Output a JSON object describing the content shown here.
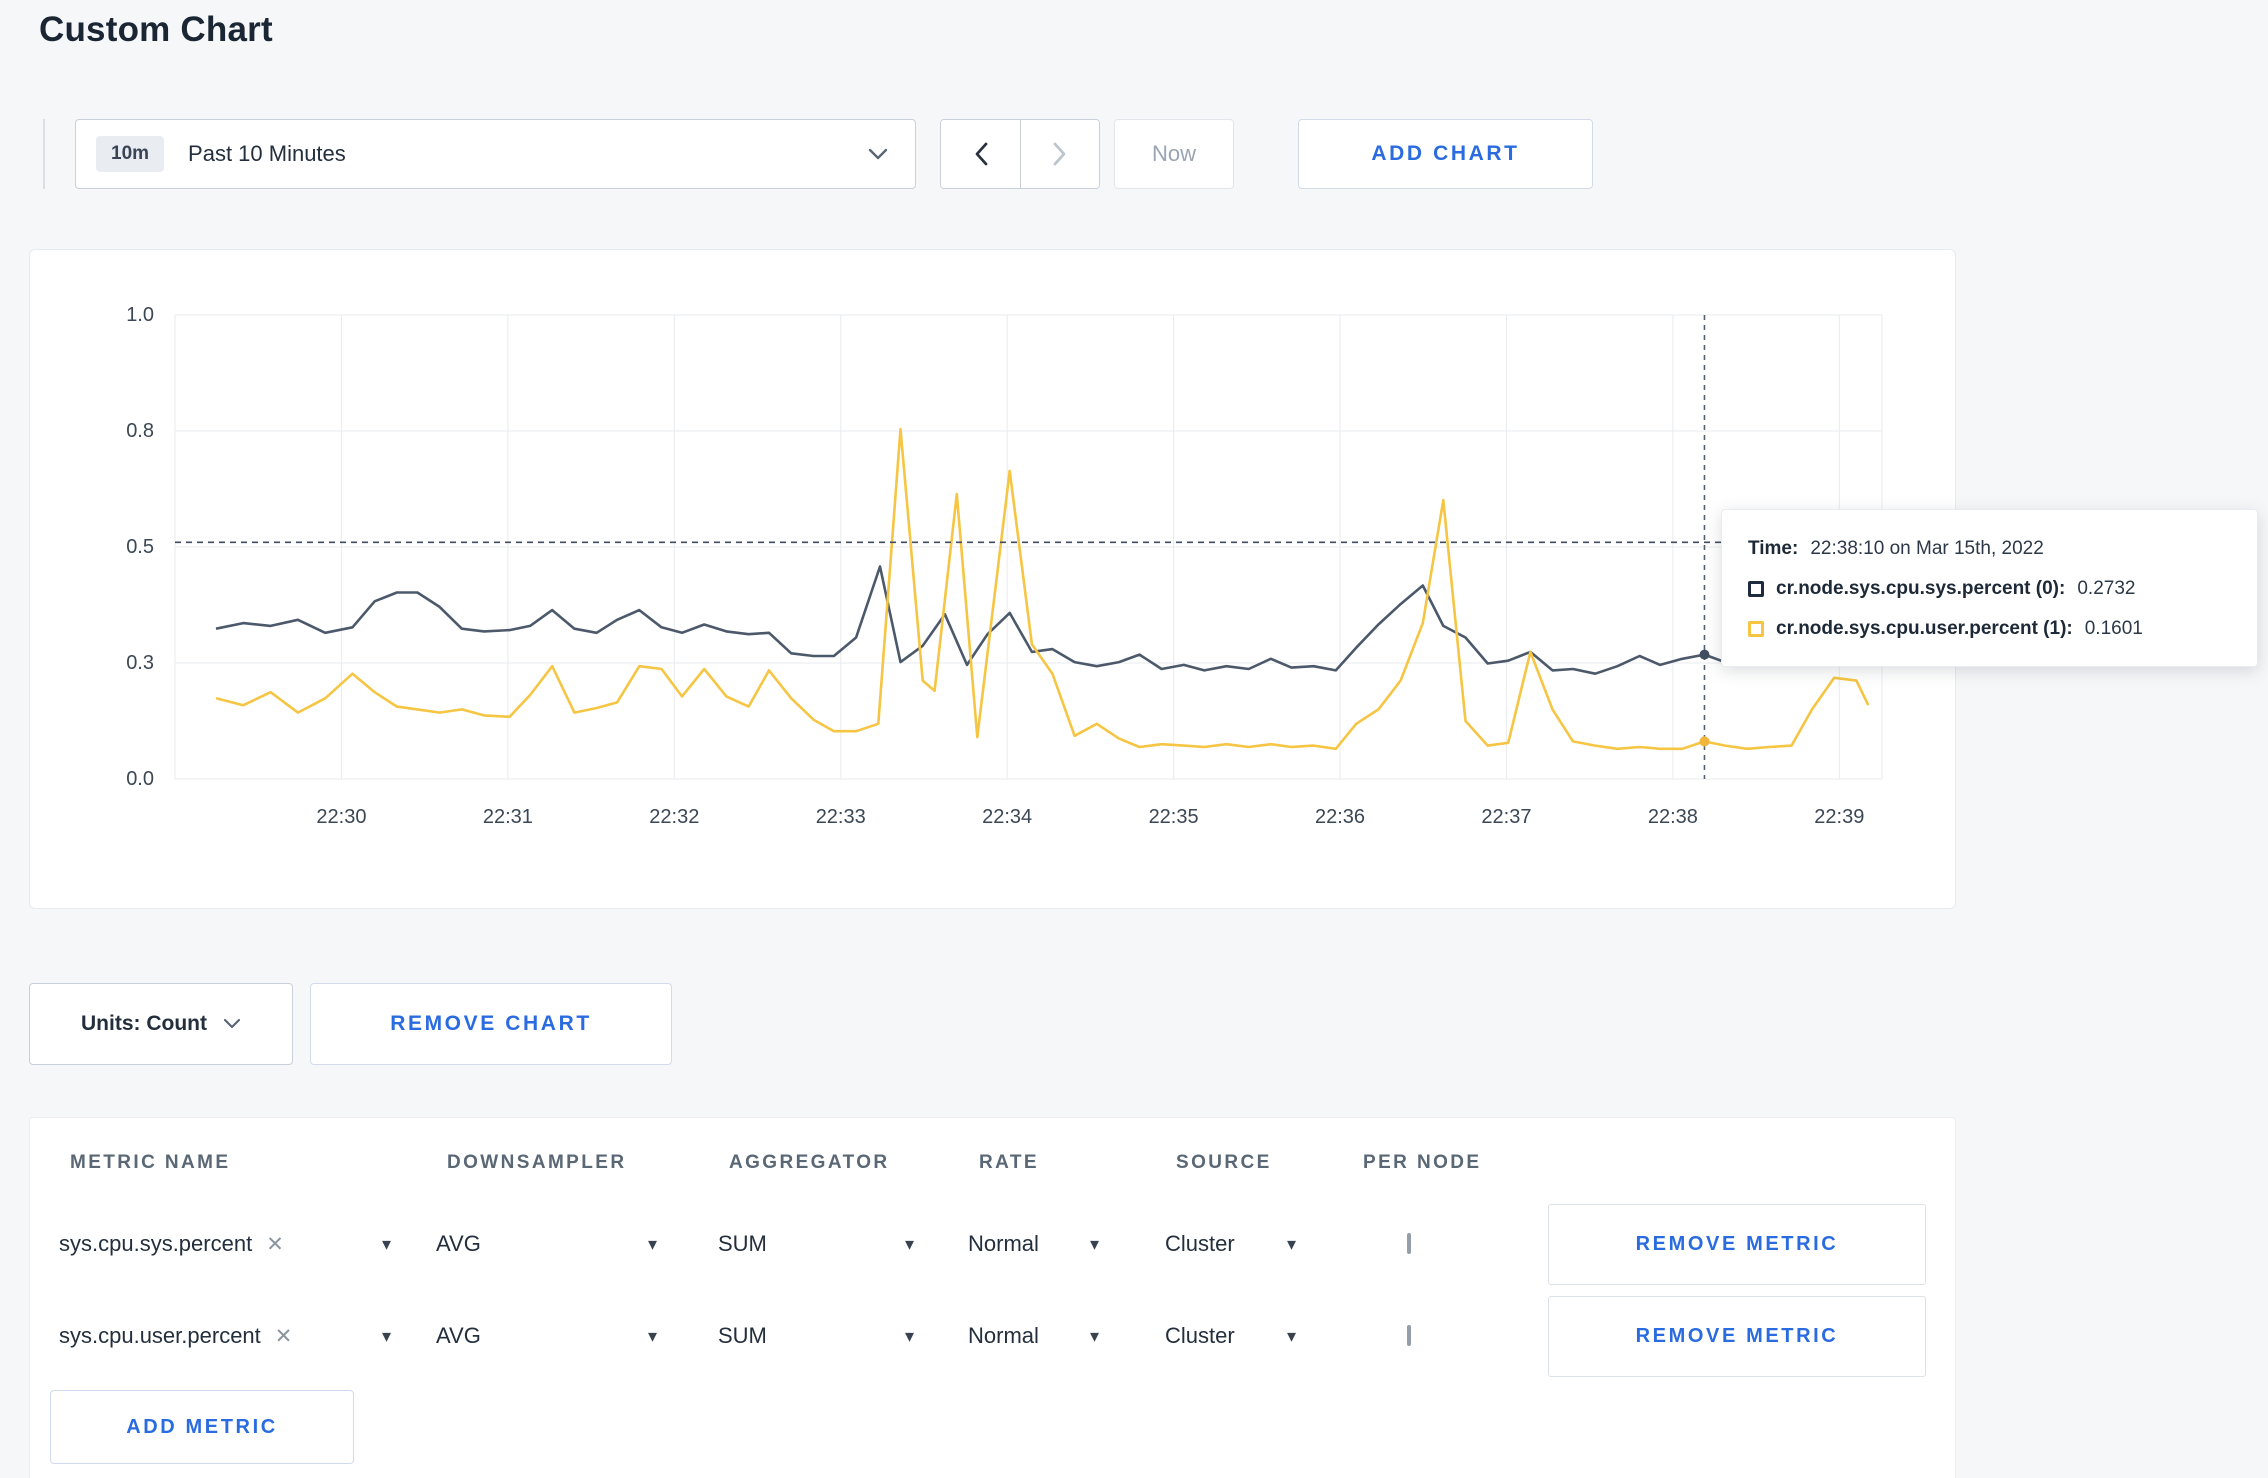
{
  "page": {
    "title": "Custom Chart"
  },
  "toolbar": {
    "time_badge": "10m",
    "time_label": "Past 10 Minutes",
    "now_label": "Now",
    "add_chart_label": "ADD CHART"
  },
  "chart": {
    "y_ticks": [
      "1.0",
      "0.8",
      "0.5",
      "0.3",
      "0.0"
    ],
    "y_grid": [
      0,
      0.25,
      0.5,
      0.75,
      1
    ],
    "x_ticks": [
      "22:30",
      "22:31",
      "22:32",
      "22:33",
      "22:34",
      "22:35",
      "22:36",
      "22:37",
      "22:38",
      "22:39"
    ],
    "x_grid": [
      0.0975,
      0.195,
      0.2925,
      0.39,
      0.4875,
      0.585,
      0.6825,
      0.78,
      0.8775,
      0.975
    ],
    "grid_color": "#e9ebee",
    "hline_fy": 0.49,
    "hline_color": "#3f4c60",
    "crosshair": {
      "fx": 0.896,
      "color": "#55606e",
      "markers": [
        {
          "fy": 0.732,
          "color": "#414e60"
        },
        {
          "fy": 0.919,
          "color": "#f0b63b"
        }
      ]
    },
    "series": [
      {
        "id": "sys-percent",
        "name": "cr.node.sys.cpu.sys.percent",
        "color": "#4c596b",
        "points": [
          [
            0.024,
            0.676
          ],
          [
            0.04,
            0.664
          ],
          [
            0.056,
            0.67
          ],
          [
            0.072,
            0.657
          ],
          [
            0.088,
            0.685
          ],
          [
            0.104,
            0.673
          ],
          [
            0.117,
            0.617
          ],
          [
            0.13,
            0.598
          ],
          [
            0.142,
            0.598
          ],
          [
            0.155,
            0.629
          ],
          [
            0.168,
            0.676
          ],
          [
            0.181,
            0.682
          ],
          [
            0.196,
            0.679
          ],
          [
            0.208,
            0.67
          ],
          [
            0.221,
            0.636
          ],
          [
            0.234,
            0.676
          ],
          [
            0.247,
            0.685
          ],
          [
            0.259,
            0.657
          ],
          [
            0.272,
            0.636
          ],
          [
            0.285,
            0.673
          ],
          [
            0.297,
            0.685
          ],
          [
            0.31,
            0.667
          ],
          [
            0.323,
            0.682
          ],
          [
            0.336,
            0.688
          ],
          [
            0.348,
            0.685
          ],
          [
            0.361,
            0.729
          ],
          [
            0.374,
            0.735
          ],
          [
            0.386,
            0.735
          ],
          [
            0.399,
            0.695
          ],
          [
            0.413,
            0.542
          ],
          [
            0.425,
            0.748
          ],
          [
            0.438,
            0.713
          ],
          [
            0.451,
            0.645
          ],
          [
            0.464,
            0.754
          ],
          [
            0.476,
            0.688
          ],
          [
            0.489,
            0.642
          ],
          [
            0.502,
            0.726
          ],
          [
            0.514,
            0.72
          ],
          [
            0.527,
            0.748
          ],
          [
            0.54,
            0.757
          ],
          [
            0.553,
            0.748
          ],
          [
            0.565,
            0.732
          ],
          [
            0.578,
            0.763
          ],
          [
            0.591,
            0.754
          ],
          [
            0.603,
            0.766
          ],
          [
            0.616,
            0.757
          ],
          [
            0.629,
            0.763
          ],
          [
            0.642,
            0.741
          ],
          [
            0.654,
            0.76
          ],
          [
            0.667,
            0.757
          ],
          [
            0.68,
            0.766
          ],
          [
            0.692,
            0.717
          ],
          [
            0.705,
            0.667
          ],
          [
            0.718,
            0.623
          ],
          [
            0.731,
            0.583
          ],
          [
            0.743,
            0.67
          ],
          [
            0.756,
            0.695
          ],
          [
            0.769,
            0.751
          ],
          [
            0.781,
            0.745
          ],
          [
            0.794,
            0.726
          ],
          [
            0.807,
            0.766
          ],
          [
            0.819,
            0.763
          ],
          [
            0.832,
            0.773
          ],
          [
            0.845,
            0.757
          ],
          [
            0.858,
            0.735
          ],
          [
            0.87,
            0.754
          ],
          [
            0.883,
            0.741
          ],
          [
            0.896,
            0.732
          ],
          [
            0.908,
            0.748
          ],
          [
            0.921,
            0.726
          ],
          [
            0.934,
            0.735
          ],
          [
            0.947,
            0.741
          ],
          [
            0.959,
            0.751
          ],
          [
            0.972,
            0.741
          ],
          [
            0.985,
            0.751
          ]
        ]
      },
      {
        "id": "user-percent",
        "name": "cr.node.sys.cpu.user.percent",
        "color": "#f5c543",
        "points": [
          [
            0.024,
            0.826
          ],
          [
            0.04,
            0.841
          ],
          [
            0.056,
            0.813
          ],
          [
            0.072,
            0.857
          ],
          [
            0.088,
            0.826
          ],
          [
            0.104,
            0.773
          ],
          [
            0.117,
            0.813
          ],
          [
            0.13,
            0.844
          ],
          [
            0.142,
            0.85
          ],
          [
            0.155,
            0.857
          ],
          [
            0.168,
            0.85
          ],
          [
            0.181,
            0.863
          ],
          [
            0.196,
            0.866
          ],
          [
            0.208,
            0.819
          ],
          [
            0.221,
            0.757
          ],
          [
            0.234,
            0.857
          ],
          [
            0.247,
            0.847
          ],
          [
            0.259,
            0.835
          ],
          [
            0.272,
            0.757
          ],
          [
            0.285,
            0.763
          ],
          [
            0.297,
            0.822
          ],
          [
            0.31,
            0.763
          ],
          [
            0.323,
            0.822
          ],
          [
            0.336,
            0.844
          ],
          [
            0.348,
            0.766
          ],
          [
            0.361,
            0.826
          ],
          [
            0.374,
            0.872
          ],
          [
            0.386,
            0.897
          ],
          [
            0.399,
            0.897
          ],
          [
            0.412,
            0.881
          ],
          [
            0.425,
            0.246
          ],
          [
            0.438,
            0.788
          ],
          [
            0.445,
            0.81
          ],
          [
            0.458,
            0.386
          ],
          [
            0.47,
            0.91
          ],
          [
            0.489,
            0.336
          ],
          [
            0.502,
            0.71
          ],
          [
            0.514,
            0.773
          ],
          [
            0.527,
            0.907
          ],
          [
            0.54,
            0.881
          ],
          [
            0.553,
            0.913
          ],
          [
            0.565,
            0.931
          ],
          [
            0.578,
            0.925
          ],
          [
            0.591,
            0.928
          ],
          [
            0.603,
            0.931
          ],
          [
            0.616,
            0.925
          ],
          [
            0.629,
            0.931
          ],
          [
            0.642,
            0.925
          ],
          [
            0.654,
            0.931
          ],
          [
            0.667,
            0.928
          ],
          [
            0.68,
            0.935
          ],
          [
            0.692,
            0.881
          ],
          [
            0.705,
            0.85
          ],
          [
            0.718,
            0.788
          ],
          [
            0.731,
            0.664
          ],
          [
            0.743,
            0.399
          ],
          [
            0.756,
            0.875
          ],
          [
            0.769,
            0.928
          ],
          [
            0.781,
            0.922
          ],
          [
            0.794,
            0.726
          ],
          [
            0.807,
            0.85
          ],
          [
            0.819,
            0.919
          ],
          [
            0.832,
            0.928
          ],
          [
            0.845,
            0.935
          ],
          [
            0.858,
            0.931
          ],
          [
            0.87,
            0.935
          ],
          [
            0.883,
            0.935
          ],
          [
            0.896,
            0.919
          ],
          [
            0.908,
            0.928
          ],
          [
            0.921,
            0.935
          ],
          [
            0.934,
            0.931
          ],
          [
            0.947,
            0.928
          ],
          [
            0.959,
            0.85
          ],
          [
            0.972,
            0.782
          ],
          [
            0.985,
            0.788
          ],
          [
            0.992,
            0.841
          ]
        ]
      }
    ],
    "tooltip": {
      "time_label": "Time:",
      "time_value": "22:38:10 on Mar 15th, 2022",
      "rows": [
        {
          "label": "cr.node.sys.cpu.sys.percent (0):",
          "value": "0.2732",
          "swatch_color": "#1d2b3e"
        },
        {
          "label": "cr.node.sys.cpu.user.percent (1):",
          "value": "0.1601",
          "swatch_color": "#f5c543"
        }
      ]
    }
  },
  "units": {
    "label": "Units: Count",
    "remove_chart_label": "REMOVE CHART"
  },
  "metrics_table": {
    "headers": [
      "METRIC NAME",
      "DOWNSAMPLER",
      "AGGREGATOR",
      "RATE",
      "SOURCE",
      "PER NODE"
    ],
    "rows": [
      {
        "metric": "sys.cpu.sys.percent",
        "downsampler": "AVG",
        "aggregator": "SUM",
        "rate": "Normal",
        "source": "Cluster",
        "per_node": false,
        "remove_label": "REMOVE METRIC"
      },
      {
        "metric": "sys.cpu.user.percent",
        "downsampler": "AVG",
        "aggregator": "SUM",
        "rate": "Normal",
        "source": "Cluster",
        "per_node": false,
        "remove_label": "REMOVE METRIC"
      }
    ],
    "add_metric_label": "ADD METRIC"
  },
  "colors": {
    "accent_blue": "#2a6ce0",
    "series_sys": "#4c596b",
    "series_user": "#f5c543",
    "page_background": "#f6f7f9"
  }
}
